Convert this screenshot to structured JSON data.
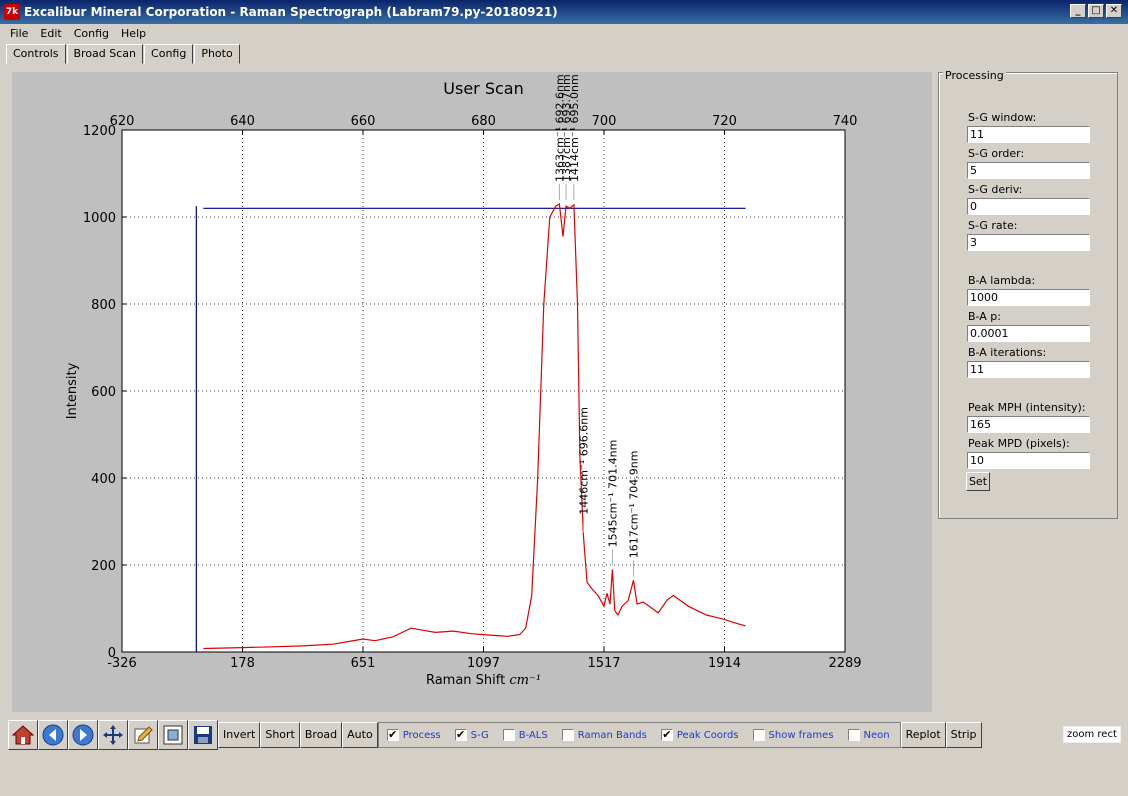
{
  "window": {
    "title": "Excalibur Mineral Corporation - Raman Spectrograph (Labram79.py-20180921)",
    "icon_text": "7k",
    "buttons": [
      "_",
      "□",
      "✕"
    ]
  },
  "menu": [
    "File",
    "Edit",
    "Config",
    "Help"
  ],
  "tabs": [
    "Controls",
    "Broad Scan",
    "Config",
    "Photo"
  ],
  "active_tab": 1,
  "chart_data": {
    "type": "line",
    "title": "User Scan",
    "xlabel": "Raman Shift",
    "xlabel_unit": "cm⁻¹",
    "ylabel": "Intensity",
    "ylim": [
      0,
      1200
    ],
    "y_ticks": [
      "0",
      "200",
      "400",
      "600",
      "800",
      "1000",
      "1200"
    ],
    "x_ticks_bottom": [
      "-326",
      "178",
      "651",
      "1097",
      "1517",
      "1914",
      "2289"
    ],
    "x_ticks_top": [
      "620",
      "640",
      "660",
      "680",
      "700",
      "720",
      "740"
    ],
    "xlim_top_nm": [
      620,
      740
    ],
    "grid": true,
    "series_color": "#e00000",
    "baseline_color": "#00008b",
    "peaks": [
      {
        "label": "1363cm⁻¹ 692.6nm",
        "nm": 692.6,
        "y": 1030
      },
      {
        "label": "1387cm⁻¹ 693.7nm",
        "nm": 693.7,
        "y": 1030
      },
      {
        "label": "1414cm⁻¹ 695.0nm",
        "nm": 695.0,
        "y": 1030
      },
      {
        "label": "1446cm⁻¹ 696.6nm",
        "nm": 696.6,
        "y": 265
      },
      {
        "label": "1545cm⁻¹ 701.4nm",
        "nm": 701.4,
        "y": 190
      },
      {
        "label": "1617cm⁻¹ 704.9nm",
        "nm": 704.9,
        "y": 165
      }
    ],
    "spectrum_nm": [
      633.5,
      640,
      645,
      650,
      655,
      658,
      660,
      662,
      665,
      668,
      670,
      672,
      675,
      678,
      680,
      682,
      684,
      686,
      687,
      688,
      689,
      690,
      691,
      692,
      692.6,
      693.2,
      693.7,
      694.3,
      695.0,
      695.6,
      696.0,
      696.6,
      697.2,
      698,
      699,
      700,
      700.5,
      701,
      701.4,
      701.8,
      702.3,
      703,
      704,
      704.9,
      705.5,
      706.5,
      707.5,
      709,
      710.5,
      711.5,
      712.5,
      714,
      715.5,
      717,
      718.5,
      720,
      721.5,
      723.5
    ],
    "spectrum_y": [
      8,
      10,
      12,
      14,
      18,
      25,
      30,
      26,
      35,
      55,
      50,
      45,
      48,
      42,
      40,
      38,
      36,
      40,
      55,
      130,
      400,
      800,
      1000,
      1025,
      1030,
      955,
      1025,
      1020,
      1028,
      800,
      450,
      265,
      160,
      145,
      130,
      105,
      135,
      110,
      190,
      95,
      85,
      105,
      118,
      165,
      110,
      115,
      105,
      90,
      120,
      130,
      120,
      105,
      95,
      85,
      80,
      75,
      68,
      60
    ],
    "baseline": {
      "y": 1020,
      "x_start_nm": 633.5,
      "x_end_nm": 723.5
    }
  },
  "panel": {
    "title": "Processing",
    "fields": [
      {
        "label": "S-G window:",
        "value": "11"
      },
      {
        "label": "S-G order:",
        "value": "5"
      },
      {
        "label": "S-G deriv:",
        "value": "0"
      },
      {
        "label": "S-G rate:",
        "value": "3"
      },
      {
        "label": "B-A lambda:",
        "value": "1000"
      },
      {
        "label": "B-A p:",
        "value": "0.0001"
      },
      {
        "label": "B-A iterations:",
        "value": "11"
      },
      {
        "label": "Peak MPH (intensity):",
        "value": "165"
      },
      {
        "label": "Peak MPD (pixels):",
        "value": "10"
      }
    ],
    "set_label": "Set"
  },
  "toolbar": {
    "icons": [
      "home-icon",
      "back-icon",
      "forward-icon",
      "pan-icon",
      "edit-icon",
      "subplots-icon",
      "save-icon"
    ],
    "buttons": [
      "Invert",
      "Short",
      "Broad",
      "Auto"
    ],
    "checks": [
      {
        "label": "Process",
        "checked": true
      },
      {
        "label": "S-G",
        "checked": true
      },
      {
        "label": "B-ALS",
        "checked": false
      },
      {
        "label": "Raman Bands",
        "checked": false
      },
      {
        "label": "Peak Coords",
        "checked": true
      },
      {
        "label": "Show frames",
        "checked": false
      },
      {
        "label": "Neon",
        "checked": false
      }
    ],
    "right_buttons": [
      "Replot",
      "Strip"
    ]
  },
  "status": {
    "zoom_mode": "zoom rect"
  }
}
